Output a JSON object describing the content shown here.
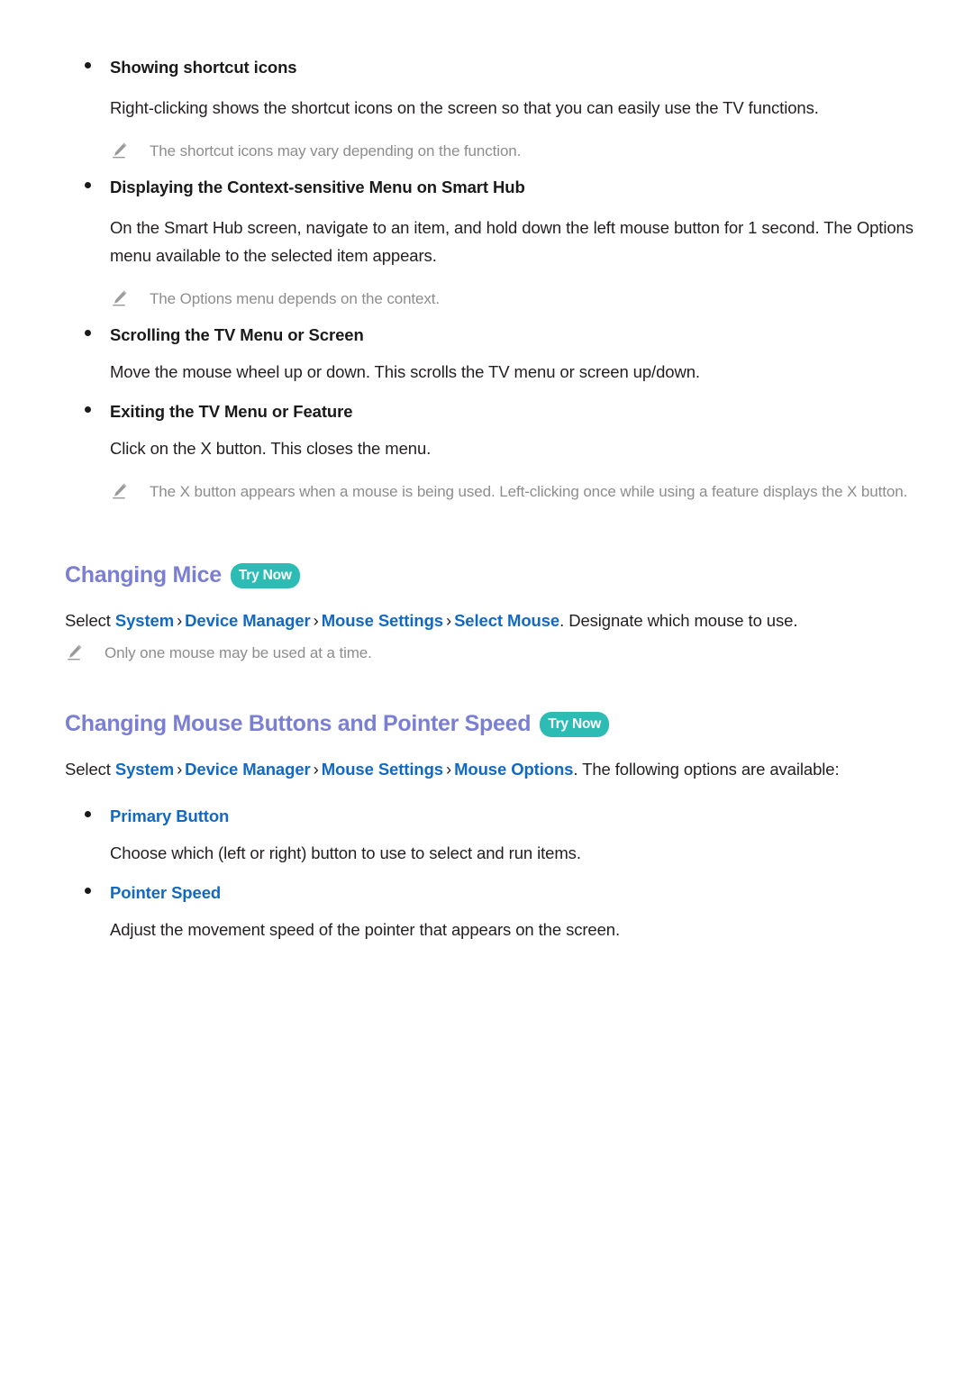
{
  "colors": {
    "heading": "#7b7fd4",
    "link": "#1269c4",
    "badge_bg": "#2cbcb4",
    "badge_text": "#ffffff",
    "body_text": "#231f20",
    "note_text": "#8d8d8d"
  },
  "sections": {
    "mouse_actions": {
      "items": [
        {
          "label": "Showing shortcut icons",
          "body": "Right-clicking shows the shortcut icons on the screen so that you can easily use the TV functions.",
          "note": "The shortcut icons may vary depending on the function."
        },
        {
          "label": "Displaying the Context-sensitive Menu on Smart Hub",
          "body": "On the Smart Hub screen, navigate to an item, and hold down the left mouse button for 1 second. The Options menu available to the selected item appears.",
          "note": "The Options menu depends on the context."
        },
        {
          "label": "Scrolling the TV Menu or Screen",
          "body": "Move the mouse wheel up or down. This scrolls the TV menu or screen up/down.",
          "note": null
        },
        {
          "label": "Exiting the TV Menu or Feature",
          "body": "Click on the X button. This closes the menu.",
          "note": "The X button appears when a mouse is being used. Left-clicking once while using a feature displays the X button."
        }
      ]
    },
    "changing_mice": {
      "heading": "Changing Mice",
      "badge": "Try Now",
      "path_prefix": "Select ",
      "path": [
        "System",
        "Device Manager",
        "Mouse Settings",
        "Select Mouse"
      ],
      "separator": "›",
      "path_suffix": ". Designate which mouse to use.",
      "note": "Only one mouse may be used at a time."
    },
    "mouse_buttons_pointer_speed": {
      "heading": "Changing Mouse Buttons and Pointer Speed",
      "badge": "Try Now",
      "path_prefix": "Select ",
      "path": [
        "System",
        "Device Manager",
        "Mouse Settings",
        "Mouse Options"
      ],
      "separator": "›",
      "path_suffix": ". The following options are available:",
      "options": [
        {
          "label": "Primary Button",
          "body": "Choose which (left or right) button to use to select and run items."
        },
        {
          "label": "Pointer Speed",
          "body": "Adjust the movement speed of the pointer that appears on the screen."
        }
      ]
    }
  },
  "icons": {
    "note": "pencil-icon",
    "bullet": "bullet-dot-icon"
  }
}
